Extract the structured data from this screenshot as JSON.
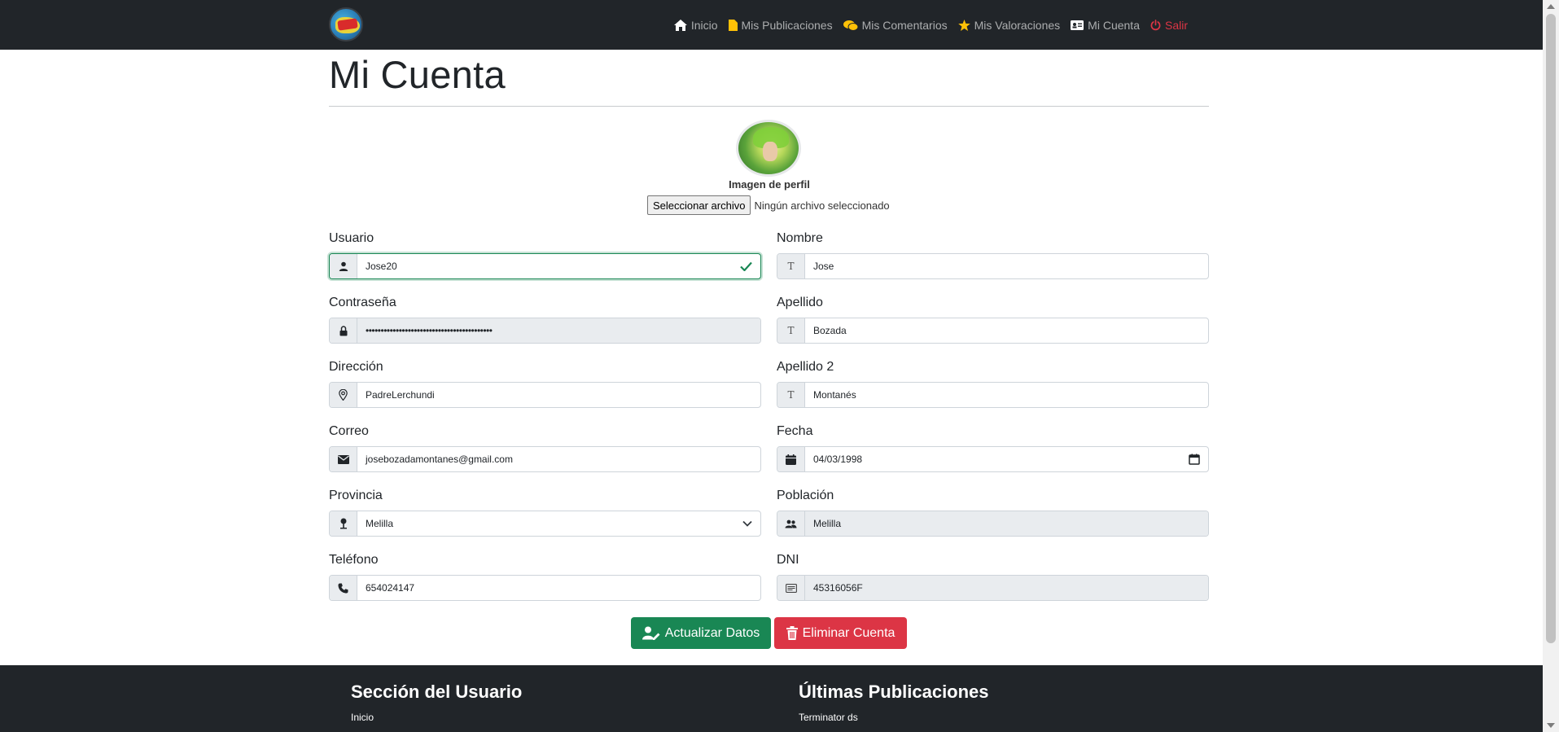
{
  "nav": {
    "links": [
      {
        "label": "Inicio",
        "icon": "home-icon"
      },
      {
        "label": "Mis Publicaciones",
        "icon": "document-icon"
      },
      {
        "label": "Mis Comentarios",
        "icon": "chat-icon"
      },
      {
        "label": "Mis Valoraciones",
        "icon": "star-icon"
      },
      {
        "label": "Mi Cuenta",
        "icon": "id-card-icon"
      },
      {
        "label": "Salir",
        "icon": "power-icon"
      }
    ],
    "accent_yellow": "#ffc107",
    "exit_color": "#dc3545"
  },
  "page": {
    "title": "Mi Cuenta",
    "profile_label": "Imagen de perfil",
    "file_button": "Seleccionar archivo",
    "file_status": "Ningún archivo seleccionado"
  },
  "form": {
    "usuario": {
      "label": "Usuario",
      "value": "Jose20",
      "icon": "person-icon"
    },
    "contrasena": {
      "label": "Contraseña",
      "value": "••••••••••••••••••••••••••••••••••••••••••",
      "icon": "lock-icon"
    },
    "direccion": {
      "label": "Dirección",
      "value": "PadreLerchundi",
      "icon": "map-pin-icon"
    },
    "correo": {
      "label": "Correo",
      "value": "josebozadamontanes@gmail.com",
      "icon": "envelope-icon"
    },
    "provincia": {
      "label": "Provincia",
      "value": "Melilla",
      "icon": "pin-icon"
    },
    "telefono": {
      "label": "Teléfono",
      "value": "654024147",
      "icon": "phone-icon"
    },
    "nombre": {
      "label": "Nombre",
      "value": "Jose",
      "icon": "text-icon"
    },
    "apellido": {
      "label": "Apellido",
      "value": "Bozada",
      "icon": "text-icon"
    },
    "apellido2": {
      "label": "Apellido 2",
      "value": "Montanés",
      "icon": "text-icon"
    },
    "fecha": {
      "label": "Fecha",
      "value": "04/03/1998",
      "icon": "calendar-icon"
    },
    "poblacion": {
      "label": "Población",
      "value": "Melilla",
      "icon": "people-icon"
    },
    "dni": {
      "label": "DNI",
      "value": "45316056F",
      "icon": "id-card-icon"
    },
    "icon_t": "T"
  },
  "actions": {
    "update": "Actualizar Datos",
    "delete": "Eliminar Cuenta",
    "success_color": "#198754",
    "danger_color": "#dc3545"
  },
  "footer": {
    "user_section_title": "Sección del Usuario",
    "user_section_items": [
      "Inicio"
    ],
    "latest_title": "Últimas Publicaciones",
    "latest_items": [
      "Terminator ds"
    ]
  }
}
